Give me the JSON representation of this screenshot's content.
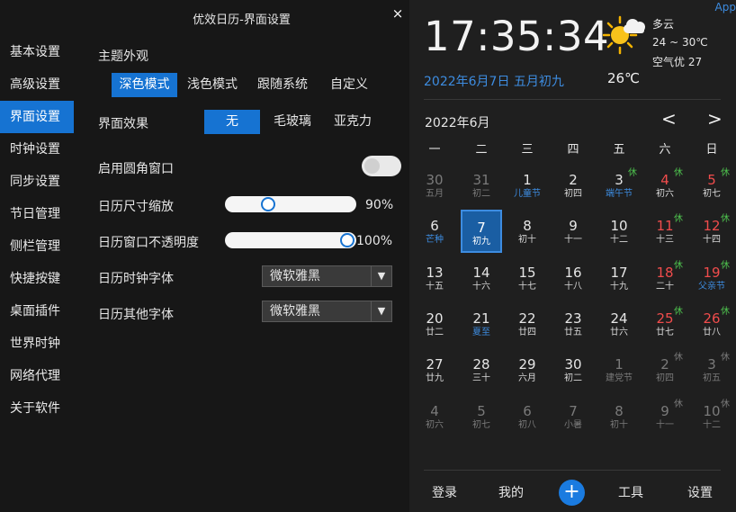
{
  "window": {
    "title": "优效日历-界面设置",
    "close_glyph": "×"
  },
  "sidebar": {
    "items": [
      {
        "label": "基本设置",
        "active": false
      },
      {
        "label": "高级设置",
        "active": false
      },
      {
        "label": "界面设置",
        "active": true
      },
      {
        "label": "时钟设置",
        "active": false
      },
      {
        "label": "同步设置",
        "active": false
      },
      {
        "label": "节日管理",
        "active": false
      },
      {
        "label": "侧栏管理",
        "active": false
      },
      {
        "label": "快捷按键",
        "active": false
      },
      {
        "label": "桌面插件",
        "active": false
      },
      {
        "label": "世界时钟",
        "active": false
      },
      {
        "label": "网络代理",
        "active": false
      },
      {
        "label": "关于软件",
        "active": false
      }
    ]
  },
  "interface": {
    "theme_title": "主题外观",
    "theme_options": [
      "深色模式",
      "浅色模式",
      "跟随系统",
      "自定义"
    ],
    "theme_selected": "深色模式",
    "effect_label": "界面效果",
    "effect_options": [
      "无",
      "毛玻璃",
      "亚克力"
    ],
    "effect_selected": "无",
    "rounded_label": "启用圆角窗口",
    "rounded_enabled": false,
    "scale_label": "日历尺寸缩放",
    "scale_value": "90%",
    "scale_level": 0.3,
    "opacity_label": "日历窗口不透明度",
    "opacity_value": "100%",
    "opacity_level": 1.0,
    "clock_font_label": "日历时钟字体",
    "clock_font_value": "微软雅黑",
    "other_font_label": "日历其他字体",
    "other_font_value": "微软雅黑",
    "dropdown_glyph": "▼"
  },
  "calendar": {
    "app_link": "App",
    "time": "17:35:34",
    "weather": {
      "desc": "多云",
      "range": "24 ~ 30℃",
      "air": "空气优 27",
      "temp": "26℃",
      "icon": "partly-cloudy-icon"
    },
    "date_line": "2022年6月7日 五月初九",
    "month_label": "2022年6月",
    "prev_glyph": "<",
    "next_glyph": ">",
    "weekdays": [
      "一",
      "二",
      "三",
      "四",
      "五",
      "六",
      "日"
    ],
    "days": [
      {
        "n": "30",
        "s": "五月",
        "other": true
      },
      {
        "n": "31",
        "s": "初二",
        "other": true
      },
      {
        "n": "1",
        "s": "儿童节",
        "blue": true
      },
      {
        "n": "2",
        "s": "初四"
      },
      {
        "n": "3",
        "s": "端午节",
        "blue": true,
        "rest": "休"
      },
      {
        "n": "4",
        "s": "初六",
        "red": true,
        "rest": "休"
      },
      {
        "n": "5",
        "s": "初七",
        "red": true,
        "rest": "休"
      },
      {
        "n": "6",
        "s": "芒种",
        "blue": true
      },
      {
        "n": "7",
        "s": "初九",
        "today": true
      },
      {
        "n": "8",
        "s": "初十"
      },
      {
        "n": "9",
        "s": "十一"
      },
      {
        "n": "10",
        "s": "十二"
      },
      {
        "n": "11",
        "s": "十三",
        "red": true,
        "rest": "休"
      },
      {
        "n": "12",
        "s": "十四",
        "red": true,
        "rest": "休"
      },
      {
        "n": "13",
        "s": "十五"
      },
      {
        "n": "14",
        "s": "十六"
      },
      {
        "n": "15",
        "s": "十七"
      },
      {
        "n": "16",
        "s": "十八"
      },
      {
        "n": "17",
        "s": "十九"
      },
      {
        "n": "18",
        "s": "二十",
        "red": true,
        "rest": "休"
      },
      {
        "n": "19",
        "s": "父亲节",
        "blue": true,
        "red": true,
        "rest": "休"
      },
      {
        "n": "20",
        "s": "廿二"
      },
      {
        "n": "21",
        "s": "夏至",
        "blue": true
      },
      {
        "n": "22",
        "s": "廿四"
      },
      {
        "n": "23",
        "s": "廿五"
      },
      {
        "n": "24",
        "s": "廿六"
      },
      {
        "n": "25",
        "s": "廿七",
        "red": true,
        "rest": "休"
      },
      {
        "n": "26",
        "s": "廿八",
        "red": true,
        "rest": "休"
      },
      {
        "n": "27",
        "s": "廿九"
      },
      {
        "n": "28",
        "s": "三十"
      },
      {
        "n": "29",
        "s": "六月"
      },
      {
        "n": "30",
        "s": "初二"
      },
      {
        "n": "1",
        "s": "建党节",
        "other": true
      },
      {
        "n": "2",
        "s": "初四",
        "other": true,
        "rest": "休"
      },
      {
        "n": "3",
        "s": "初五",
        "other": true,
        "rest": "休"
      },
      {
        "n": "4",
        "s": "初六",
        "other": true
      },
      {
        "n": "5",
        "s": "初七",
        "other": true
      },
      {
        "n": "6",
        "s": "初八",
        "other": true
      },
      {
        "n": "7",
        "s": "小暑",
        "other": true
      },
      {
        "n": "8",
        "s": "初十",
        "other": true
      },
      {
        "n": "9",
        "s": "十一",
        "other": true,
        "rest": "休"
      },
      {
        "n": "10",
        "s": "十二",
        "other": true,
        "rest": "休"
      }
    ],
    "bottom": {
      "login": "登录",
      "mine": "我的",
      "add": "+",
      "tools": "工具",
      "settings": "设置"
    }
  },
  "colors": {
    "accent": "#1673d2",
    "link": "#3d8ce0",
    "weekend_red": "#f04c4c",
    "rest_green": "#4ec24e"
  }
}
